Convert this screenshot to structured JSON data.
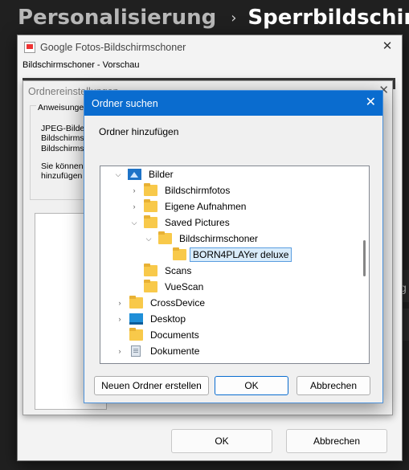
{
  "settings": {
    "breadcrumb_parent": "Personalisierung",
    "breadcrumb_separator": "›",
    "breadcrumb_current": "Sperrbildschirm",
    "side_text": "g"
  },
  "screensaver_window": {
    "title": "Google Fotos-Bildschirmschoner",
    "menu_label": "Bildschirmschoner - Vorschau",
    "close": "✕",
    "ok_label": "OK",
    "cancel_label": "Abbrechen"
  },
  "folder_settings_window": {
    "title": "Ordnereinstellungen",
    "close": "✕",
    "group_label": "Anweisungen",
    "lines": [
      "JPEG-Bilder",
      "Bildschirms",
      "Bildschirms",
      "Sie können",
      "hinzufügen"
    ]
  },
  "browse_dialog": {
    "title": "Ordner suchen",
    "close": "✕",
    "prompt": "Ordner hinzufügen",
    "tree": [
      {
        "label": "Bilder",
        "icon": "pictures-icon",
        "chevron": "expanded"
      },
      {
        "label": "Bildschirmfotos",
        "icon": "folder-icon",
        "chevron": "collapsed"
      },
      {
        "label": "Eigene Aufnahmen",
        "icon": "folder-icon",
        "chevron": "collapsed"
      },
      {
        "label": "Saved Pictures",
        "icon": "folder-icon",
        "chevron": "expanded"
      },
      {
        "label": "Bildschirmschoner",
        "icon": "folder-icon",
        "chevron": "expanded"
      },
      {
        "label": "BORN4PLAYer deluxe",
        "icon": "folder-icon",
        "chevron": "none",
        "selected": true
      },
      {
        "label": "Scans",
        "icon": "folder-icon",
        "chevron": "none"
      },
      {
        "label": "VueScan",
        "icon": "folder-icon",
        "chevron": "none"
      },
      {
        "label": "CrossDevice",
        "icon": "folder-icon",
        "chevron": "collapsed"
      },
      {
        "label": "Desktop",
        "icon": "desktop-icon",
        "chevron": "collapsed"
      },
      {
        "label": "Documents",
        "icon": "folder-icon",
        "chevron": "none"
      },
      {
        "label": "Dokumente",
        "icon": "document-icon",
        "chevron": "collapsed"
      }
    ],
    "new_folder_label": "Neuen Ordner erstellen",
    "ok_label": "OK",
    "cancel_label": "Abbrechen"
  }
}
